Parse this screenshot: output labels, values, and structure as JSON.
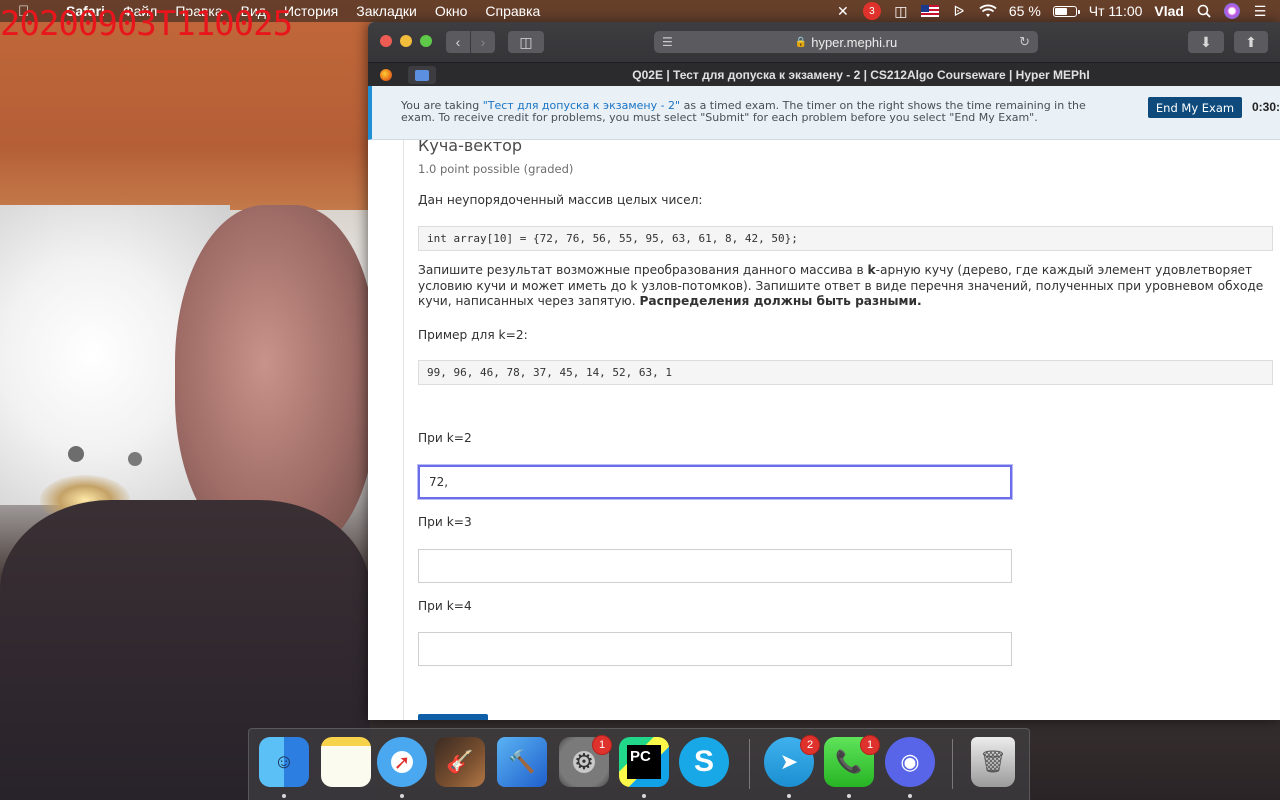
{
  "overlay": {
    "timestamp": "20200903T110025"
  },
  "menubar": {
    "app_name": "Safari",
    "menus": [
      "Файл",
      "Правка",
      "Вид",
      "История",
      "Закладки",
      "Окно",
      "Справка"
    ],
    "status": {
      "notification_count": "3",
      "battery_percent": "65 %",
      "battery_level": 0.65,
      "clock": "Чт 11:00",
      "user": "Vlad"
    }
  },
  "browser": {
    "url": "hyper.mephi.ru",
    "tab_title": "Q02E | Тест для допуска к экзамену - 2 | CS212Algo Courseware | Hyper MEPhI"
  },
  "banner": {
    "text_before": "You are taking ",
    "exam_name": "\"Тест для допуска к экзамену - 2\"",
    "text_after": " as a timed exam. The timer on the right shows the time remaining in the exam. To receive credit for problems, you must select \"Submit\" for each problem before you select \"End My Exam\".",
    "end_exam_label": "End My Exam",
    "timer": "0:30:"
  },
  "problem": {
    "title": "Куча-вектор",
    "points": "1.0 point possible (graded)",
    "intro": "Дан неупорядоченный массив целых чисел:",
    "code_array": "int array[10] = {72, 76, 56, 55, 95, 63, 61, 8, 42, 50};",
    "instructions_before": "Запишите результат возможные преобразования данного массива в ",
    "instructions_k": "k",
    "instructions_middle": "-арную кучу (дерево, где каждый элемент удовлетворяет условию кучи и может иметь до k узлов-потомков). Запишите ответ в виде перечня значений, полученных при уровневом обходе кучи, написанных через запятую. ",
    "instructions_bold": "Распределения должны быть разными.",
    "example_label": "Пример для k=2:",
    "example_code": "99, 96, 46, 78, 37, 45, 14, 52, 63, 1",
    "questions": [
      {
        "label": "При k=2",
        "value": "72,"
      },
      {
        "label": "При k=3",
        "value": ""
      },
      {
        "label": "При k=4",
        "value": ""
      }
    ]
  },
  "dock": {
    "badges": {
      "system_preferences": "1",
      "telegram": "2",
      "facetime": "1"
    },
    "pycharm_label": "PC",
    "skype_label": "S"
  }
}
